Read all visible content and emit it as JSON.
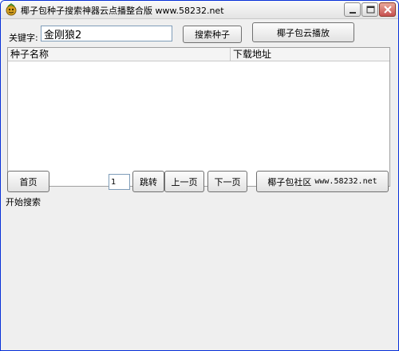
{
  "window": {
    "title": "椰子包种子搜索神器云点播整合版 www.58232.net"
  },
  "search": {
    "label": "关键字:",
    "value": "金刚狼2",
    "search_button": "搜索种子",
    "play_button": "椰子包云播放"
  },
  "list": {
    "columns": [
      "种子名称",
      "下载地址"
    ],
    "rows": []
  },
  "pager": {
    "first_button": "首页",
    "page_value": "1",
    "jump_button": "跳转",
    "prev_button": "上一页",
    "next_button": "下一页",
    "community_label": "椰子包社区",
    "community_url": "www.58232.net"
  },
  "status": {
    "text": "开始搜索"
  }
}
